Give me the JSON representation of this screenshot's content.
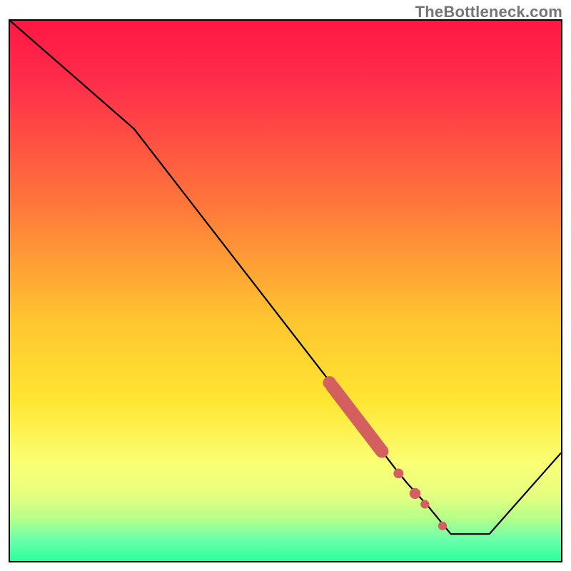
{
  "watermark": "TheBottleneck.com",
  "colors": {
    "top": "#ff1744",
    "red": "#ff2f4a",
    "orange_red": "#ff6a3a",
    "orange": "#ffb430",
    "yellow": "#ffe531",
    "pale_yellow": "#faff74",
    "yellow_green": "#c9ff80",
    "green": "#2aff9a",
    "border": "#000000",
    "line": "#000000",
    "marker": "#d35f5f"
  },
  "chart_data": {
    "type": "line",
    "title": "",
    "xlabel": "",
    "ylabel": "",
    "xlim": [
      0,
      100
    ],
    "ylim": [
      0,
      100
    ],
    "series": [
      {
        "name": "curve",
        "color": "#000000",
        "x": [
          0,
          22.5,
          62,
          67,
          70,
          72,
          76,
          80,
          87,
          100
        ],
        "y": [
          100,
          80,
          28,
          21,
          17,
          14.5,
          10,
          5,
          5,
          20
        ]
      }
    ],
    "markers": [
      {
        "name": "band-top",
        "shape": "circle",
        "color": "#d35f5f",
        "x": 58,
        "y": 33,
        "r": 1.2
      },
      {
        "name": "band-segment",
        "shape": "rounded-segment",
        "color": "#d35f5f",
        "x1": 58.5,
        "y1": 32.3,
        "x2": 67.5,
        "y2": 20.3,
        "width": 2.4
      },
      {
        "name": "dot-1",
        "shape": "circle",
        "color": "#d35f5f",
        "x": 70.5,
        "y": 16.2,
        "r": 0.9
      },
      {
        "name": "dot-2",
        "shape": "circle",
        "color": "#d35f5f",
        "x": 73.5,
        "y": 12.5,
        "r": 1.0
      },
      {
        "name": "dot-3",
        "shape": "circle",
        "color": "#d35f5f",
        "x": 75.3,
        "y": 10.5,
        "r": 0.8
      },
      {
        "name": "dot-4",
        "shape": "circle",
        "color": "#d35f5f",
        "x": 78.5,
        "y": 6.5,
        "r": 0.8
      }
    ],
    "gradient_stops": [
      {
        "offset": 0.0,
        "color": "#ff1744"
      },
      {
        "offset": 0.12,
        "color": "#ff2f4a"
      },
      {
        "offset": 0.35,
        "color": "#ff7a3a"
      },
      {
        "offset": 0.55,
        "color": "#ffc430"
      },
      {
        "offset": 0.7,
        "color": "#ffe531"
      },
      {
        "offset": 0.82,
        "color": "#faff74"
      },
      {
        "offset": 0.88,
        "color": "#e4ff80"
      },
      {
        "offset": 0.92,
        "color": "#b6ff88"
      },
      {
        "offset": 0.96,
        "color": "#6cffaa"
      },
      {
        "offset": 1.0,
        "color": "#2aff9a"
      }
    ]
  }
}
